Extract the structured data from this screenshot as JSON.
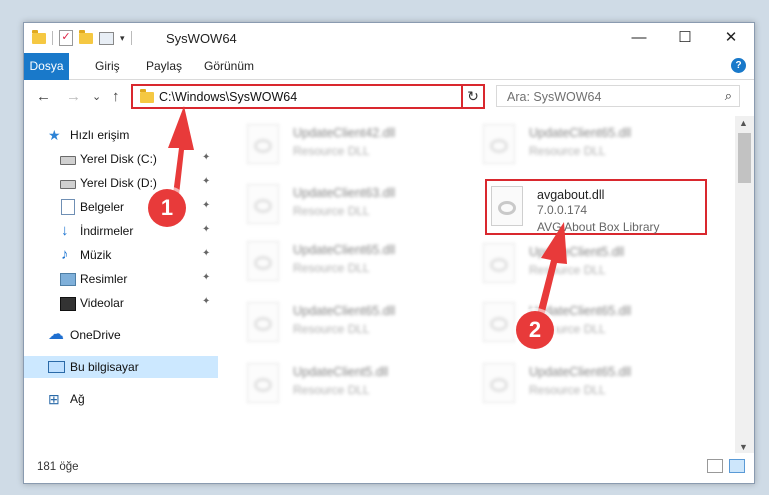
{
  "window": {
    "title": "SysWOW64",
    "minimize_icon": "—",
    "maximize_icon": "☐",
    "close_icon": "✕"
  },
  "ribbon": {
    "tabs": [
      "Dosya",
      "Giriş",
      "Paylaş",
      "Görünüm"
    ],
    "help_icon": "?"
  },
  "nav": {
    "back": "←",
    "forward": "→",
    "recent": "⌄",
    "up": "↑",
    "address": "C:\\Windows\\SysWOW64",
    "address_dropdown": "⌄",
    "refresh": "↻",
    "search_placeholder": "Ara: SysWOW64",
    "search_icon": "⌕"
  },
  "sidebar": {
    "items": [
      {
        "label": "Hızlı erişim",
        "icon": "star-icon"
      },
      {
        "label": "Yerel Disk (C:)",
        "icon": "disk-icon",
        "pinned": true
      },
      {
        "label": "Yerel Disk (D:)",
        "icon": "disk-icon",
        "pinned": true
      },
      {
        "label": "Belgeler",
        "icon": "document-icon",
        "pinned": true
      },
      {
        "label": "İndirmeler",
        "icon": "download-icon",
        "pinned": true
      },
      {
        "label": "Müzik",
        "icon": "music-icon",
        "pinned": true
      },
      {
        "label": "Resimler",
        "icon": "picture-icon",
        "pinned": true
      },
      {
        "label": "Videolar",
        "icon": "video-icon",
        "pinned": true
      },
      {
        "label": "OneDrive",
        "icon": "cloud-icon"
      },
      {
        "label": "Bu bilgisayar",
        "icon": "computer-icon",
        "selected": true
      },
      {
        "label": "Ağ",
        "icon": "network-icon"
      }
    ],
    "pin_glyph": "📌"
  },
  "files": {
    "left": [
      {
        "name": "UpdateClient42.dll",
        "desc": "Resource DLL"
      },
      {
        "name": "UpdateClient63.dll",
        "desc": "Resource DLL"
      },
      {
        "name": "UpdateClient65.dll",
        "desc": "Resource DLL"
      },
      {
        "name": "UpdateClient65.dll",
        "desc": "Resource DLL"
      },
      {
        "name": "UpdateClient5.dll",
        "desc": "Resource DLL"
      }
    ],
    "right": [
      {
        "name": "UpdateClient65.dll",
        "desc": "Resource DLL"
      },
      {
        "name": "UpdateClient5.dll",
        "desc": "Resource DLL"
      },
      {
        "name": "UpdateClient65.dll",
        "desc": "Resource DLL"
      },
      {
        "name": "UpdateClient65.dll",
        "desc": "Resource DLL"
      }
    ],
    "highlighted": {
      "name": "avgabout.dll",
      "version": "7.0.0.174",
      "desc": "AVG About Box Library"
    }
  },
  "status": {
    "count": "181 öğe"
  },
  "annotations": {
    "badge1": "1",
    "badge2": "2",
    "color": "#e83a3a"
  }
}
